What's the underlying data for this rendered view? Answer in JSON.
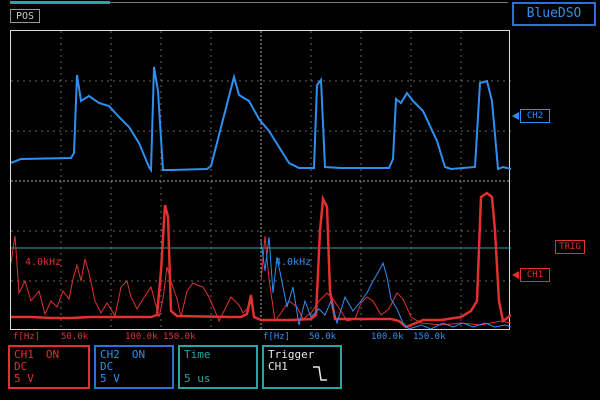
{
  "pos_label": "POS",
  "brand": "BlueDSO",
  "markers": {
    "ch2": "CH2",
    "trig": "TRIG",
    "ch1": "CH1"
  },
  "spectrum": {
    "left_peak_label": "4.0kHz",
    "right_peak_label": "4.0kHz",
    "left_axis": [
      "f[Hz]",
      "50.0k",
      "100.0k",
      "150.0k"
    ],
    "right_axis": [
      "f[Hz]",
      "50.0k",
      "100.0k",
      "150.0k"
    ]
  },
  "panels": {
    "ch1": {
      "name": "CH1",
      "state": "ON",
      "coupling": "DC",
      "scale": "5 V"
    },
    "ch2": {
      "name": "CH2",
      "state": "ON",
      "coupling": "DC",
      "scale": "5 V"
    },
    "time": {
      "title": "Time",
      "value": "5 us"
    },
    "trigger": {
      "title": "Trigger",
      "source": "CH1"
    }
  },
  "colors": {
    "ch1": "#e23030",
    "ch2": "#2f8ff0",
    "accent": "#2aa4a4",
    "grid": "#bbbbbb"
  }
}
